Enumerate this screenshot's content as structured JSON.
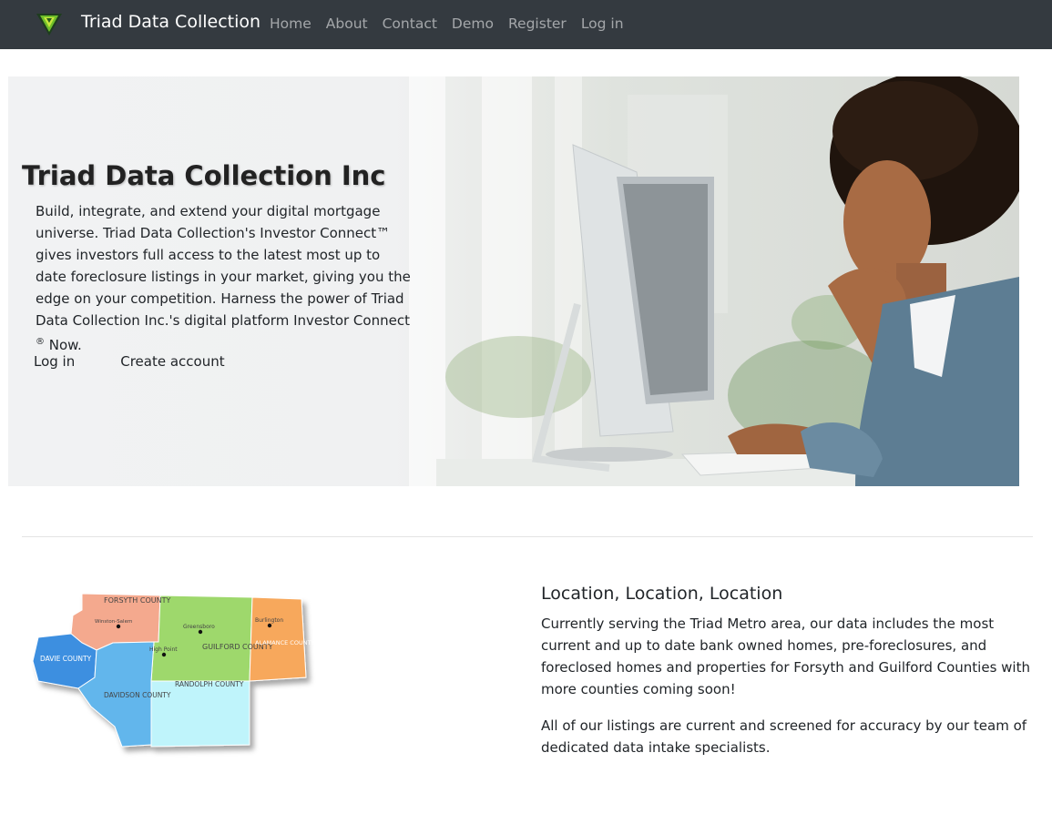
{
  "header": {
    "brand": "Triad Data Collection",
    "nav": [
      "Home",
      "About",
      "Contact",
      "Demo",
      "Register",
      "Log in"
    ],
    "logo_icon": "triad-triangle-logo"
  },
  "hero": {
    "title": "Triad Data Collection Inc",
    "text_before_sup": "Build, integrate, and extend your digital mortgage universe. Triad Data Collection's Investor Connect™ gives investors full access to the latest most up to date foreclosure listings in your market, giving you the edge on your competition. Harness the power of Triad Data Collection Inc.'s digital platform Investor Connect ",
    "sup": "®",
    "text_after_sup": " Now.",
    "login_label": "Log in",
    "create_label": "Create account"
  },
  "map": {
    "counties": [
      "FORSYTH COUNTY",
      "GUILFORD COUNTY",
      "ALAMANCE COUNTY",
      "DAVIE COUNTY",
      "DAVIDSON COUNTY",
      "RANDOLPH COUNTY"
    ],
    "cities": [
      "Winston-Salem",
      "Greensboro",
      "High Point",
      "Burlington"
    ]
  },
  "location": {
    "title": "Location, Location, Location",
    "p1": "Currently serving the Triad Metro area, our data includes the most current and up to date bank owned homes, pre-foreclosures, and foreclosed homes and properties for Forsyth and Guilford Counties with more counties coming soon!",
    "p2": "All of our listings are current and screened for accuracy by our team of dedicated data intake specialists."
  },
  "colors": {
    "navbar": "#343a40",
    "forsyth": "#f4a98e",
    "guilford": "#9ed86c",
    "alamance": "#f7a85c",
    "davie": "#3e8fe0",
    "davidson": "#62b6ec",
    "randolph": "#bff4fb"
  }
}
